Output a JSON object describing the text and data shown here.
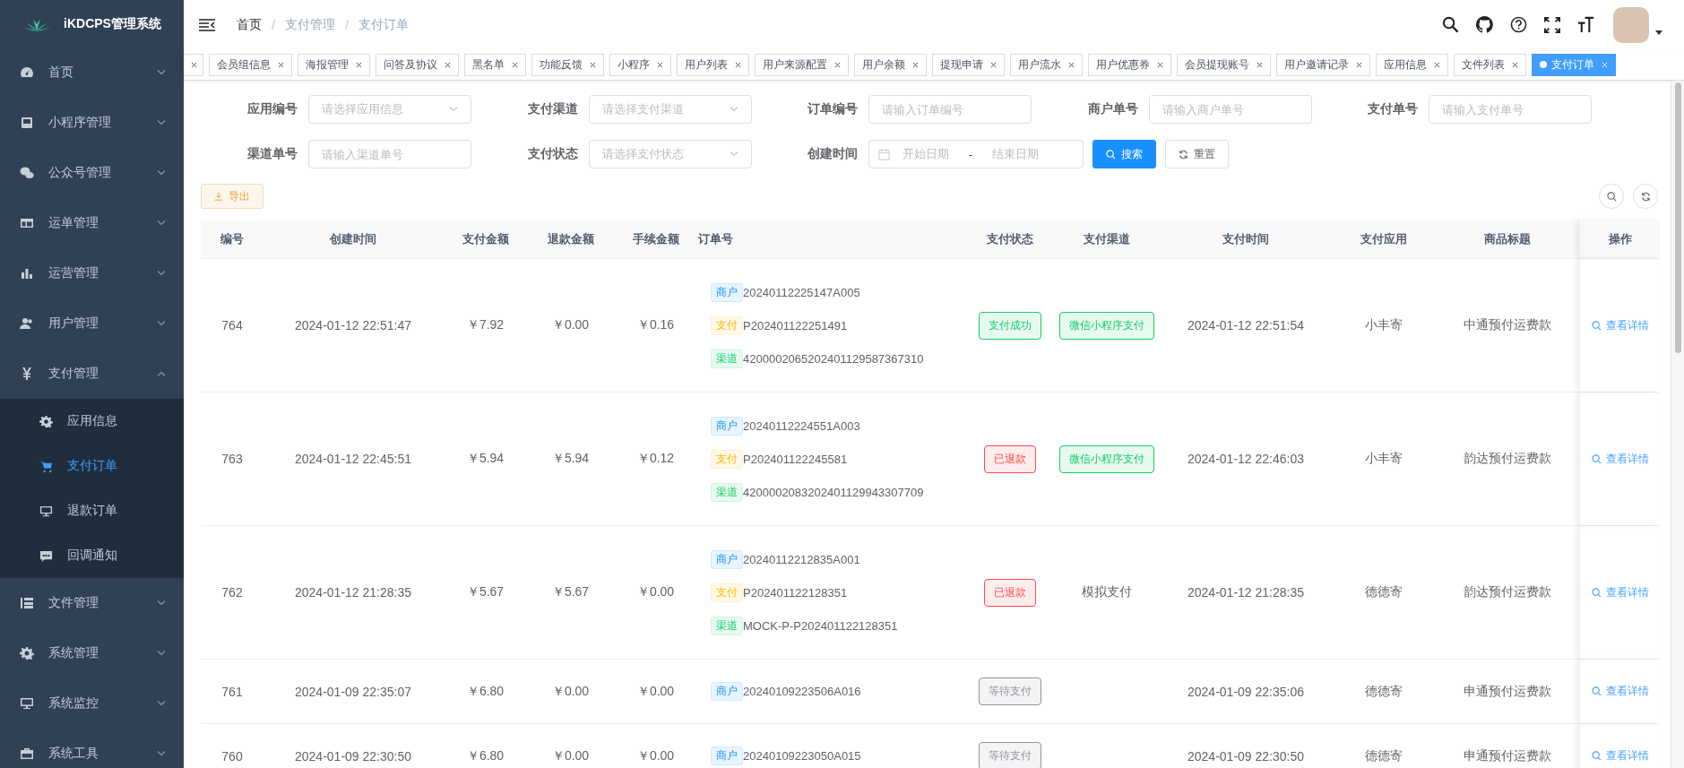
{
  "app": {
    "title": "iKDCPS管理系统"
  },
  "sidebar": {
    "items": [
      {
        "label": "首页",
        "expanded": false
      },
      {
        "label": "小程序管理",
        "expanded": false
      },
      {
        "label": "公众号管理",
        "expanded": false
      },
      {
        "label": "运单管理",
        "expanded": false
      },
      {
        "label": "运营管理",
        "expanded": false
      },
      {
        "label": "用户管理",
        "expanded": false
      },
      {
        "label": "支付管理",
        "expanded": true,
        "children": [
          {
            "label": "应用信息",
            "selected": false
          },
          {
            "label": "支付订单",
            "selected": true
          },
          {
            "label": "退款订单",
            "selected": false
          },
          {
            "label": "回调通知",
            "selected": false
          }
        ]
      },
      {
        "label": "文件管理",
        "expanded": false
      },
      {
        "label": "系统管理",
        "expanded": false
      },
      {
        "label": "系统监控",
        "expanded": false
      },
      {
        "label": "系统工具",
        "expanded": false
      }
    ]
  },
  "breadcrumb": [
    "首页",
    "支付管理",
    "支付订单"
  ],
  "breadcrumb_separator": "/",
  "tags": {
    "clipped_first": true,
    "items": [
      {
        "label": "会员组信息",
        "selected": false
      },
      {
        "label": "海报管理",
        "selected": false
      },
      {
        "label": "问答及协议",
        "selected": false
      },
      {
        "label": "黑名单",
        "selected": false
      },
      {
        "label": "功能反馈",
        "selected": false
      },
      {
        "label": "小程序",
        "selected": false
      },
      {
        "label": "用户列表",
        "selected": false
      },
      {
        "label": "用户来源配置",
        "selected": false
      },
      {
        "label": "用户余额",
        "selected": false
      },
      {
        "label": "提现申请",
        "selected": false
      },
      {
        "label": "用户流水",
        "selected": false
      },
      {
        "label": "用户优惠券",
        "selected": false
      },
      {
        "label": "会员提现账号",
        "selected": false
      },
      {
        "label": "用户邀请记录",
        "selected": false
      },
      {
        "label": "应用信息",
        "selected": false
      },
      {
        "label": "文件列表",
        "selected": false
      },
      {
        "label": "支付订单",
        "selected": true
      }
    ]
  },
  "filters": [
    {
      "label": "应用编号",
      "kind": "select",
      "placeholder": "请选择应用信息"
    },
    {
      "label": "支付渠道",
      "kind": "select",
      "placeholder": "请选择支付渠道"
    },
    {
      "label": "订单编号",
      "kind": "input",
      "placeholder": "请输入订单编号"
    },
    {
      "label": "商户单号",
      "kind": "input",
      "placeholder": "请输入商户单号"
    },
    {
      "label": "支付单号",
      "kind": "input",
      "placeholder": "请输入支付单号"
    },
    {
      "label": "渠道单号",
      "kind": "input",
      "placeholder": "请输入渠道单号"
    },
    {
      "label": "支付状态",
      "kind": "select",
      "placeholder": "请选择支付状态"
    },
    {
      "label": "创建时间",
      "kind": "daterange",
      "placeholder": "开始日期",
      "separator": "-",
      "placeholder_end": "结束日期"
    }
  ],
  "buttons": {
    "search": "搜索",
    "reset": "重置",
    "export": "导出"
  },
  "table": {
    "columns": [
      "编号",
      "创建时间",
      "支付金额",
      "退款金额",
      "手续金额",
      "订单号",
      "支付状态",
      "支付渠道",
      "支付时间",
      "支付应用",
      "商品标题",
      "操作"
    ],
    "rows": [
      {
        "id": "764",
        "created": "2024-01-12 22:51:47",
        "amount": "￥7.92",
        "refund": "￥0.00",
        "fee": "￥0.16",
        "orders": [
          {
            "kind": "merchant",
            "tag": "商户",
            "no": "20240112225147A005"
          },
          {
            "kind": "pay",
            "tag": "支付",
            "no": "P202401122251491"
          },
          {
            "kind": "channel",
            "tag": "渠道",
            "no": "4200002065202401129587367310"
          }
        ],
        "status": {
          "kind": "success",
          "label": "支付成功"
        },
        "channel": {
          "kind": "tag",
          "label": "微信小程序支付"
        },
        "paid_at": "2024-01-12 22:51:54",
        "app": "小丰寄",
        "title": "中通预付运费款",
        "action": "查看详情"
      },
      {
        "id": "763",
        "created": "2024-01-12 22:45:51",
        "amount": "￥5.94",
        "refund": "￥5.94",
        "fee": "￥0.12",
        "orders": [
          {
            "kind": "merchant",
            "tag": "商户",
            "no": "20240112224551A003"
          },
          {
            "kind": "pay",
            "tag": "支付",
            "no": "P202401122245581"
          },
          {
            "kind": "channel",
            "tag": "渠道",
            "no": "4200002083202401129943307709"
          }
        ],
        "status": {
          "kind": "refunded",
          "label": "已退款"
        },
        "channel": {
          "kind": "tag",
          "label": "微信小程序支付"
        },
        "paid_at": "2024-01-12 22:46:03",
        "app": "小丰寄",
        "title": "韵达预付运费款",
        "action": "查看详情"
      },
      {
        "id": "762",
        "created": "2024-01-12 21:28:35",
        "amount": "￥5.67",
        "refund": "￥5.67",
        "fee": "￥0.00",
        "orders": [
          {
            "kind": "merchant",
            "tag": "商户",
            "no": "20240112212835A001"
          },
          {
            "kind": "pay",
            "tag": "支付",
            "no": "P202401122128351"
          },
          {
            "kind": "channel",
            "tag": "渠道",
            "no": "MOCK-P-P202401122128351"
          }
        ],
        "status": {
          "kind": "refunded",
          "label": "已退款"
        },
        "channel": {
          "kind": "text",
          "label": "模拟支付"
        },
        "paid_at": "2024-01-12 21:28:35",
        "app": "德德寄",
        "title": "韵达预付运费款",
        "action": "查看详情"
      },
      {
        "id": "761",
        "created": "2024-01-09 22:35:07",
        "amount": "￥6.80",
        "refund": "￥0.00",
        "fee": "￥0.00",
        "orders": [
          {
            "kind": "merchant",
            "tag": "商户",
            "no": "20240109223506A016"
          }
        ],
        "status": {
          "kind": "waiting",
          "label": "等待支付"
        },
        "paid_at": "2024-01-09 22:35:06",
        "app": "德德寄",
        "title": "申通预付运费款",
        "action": "查看详情"
      },
      {
        "id": "760",
        "created": "2024-01-09 22:30:50",
        "amount": "￥6.80",
        "refund": "￥0.00",
        "fee": "￥0.00",
        "orders": [
          {
            "kind": "merchant",
            "tag": "商户",
            "no": "20240109223050A015"
          }
        ],
        "status": {
          "kind": "waiting",
          "label": "等待支付"
        },
        "paid_at": "2024-01-09 22:30:50",
        "app": "德德寄",
        "title": "申通预付运费款",
        "action": "查看详情"
      }
    ]
  }
}
